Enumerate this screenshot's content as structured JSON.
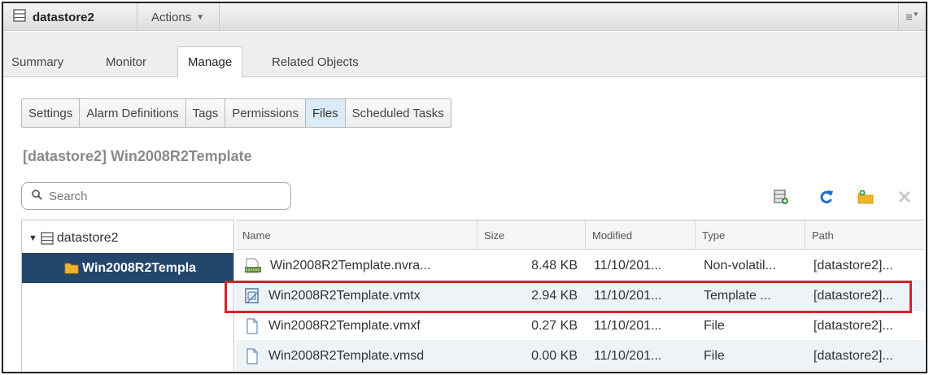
{
  "titlebar": {
    "object_name": "datastore2",
    "actions_label": "Actions",
    "menu_glyph": "≡"
  },
  "main_tabs": [
    "Summary",
    "Monitor",
    "Manage",
    "Related Objects"
  ],
  "main_tabs_active": "Manage",
  "sub_tabs": [
    "Settings",
    "Alarm Definitions",
    "Tags",
    "Permissions",
    "Files",
    "Scheduled Tasks"
  ],
  "sub_tabs_active": "Files",
  "heading": "[datastore2] Win2008R2Template",
  "search": {
    "placeholder": "Search",
    "value": ""
  },
  "toolbar_icons": [
    "register-vm-icon",
    "refresh-icon",
    "new-folder-icon",
    "delete-icon"
  ],
  "tree": {
    "root": "datastore2",
    "child": "Win2008R2Templa",
    "expanded": true
  },
  "grid": {
    "columns": [
      "Name",
      "Size",
      "Modified",
      "Type",
      "Path"
    ],
    "rows": [
      {
        "icon": "nvram-file-icon",
        "name": "Win2008R2Template.nvra...",
        "size": "8.48 KB",
        "modified": "11/10/201...",
        "type": "Non-volatil...",
        "path": "[datastore2]..."
      },
      {
        "icon": "template-file-icon",
        "name": "Win2008R2Template.vmtx",
        "size": "2.94 KB",
        "modified": "11/10/201...",
        "type": "Template ...",
        "path": "[datastore2]..."
      },
      {
        "icon": "file-icon",
        "name": "Win2008R2Template.vmxf",
        "size": "0.27 KB",
        "modified": "11/10/201...",
        "type": "File",
        "path": "[datastore2]..."
      },
      {
        "icon": "file-icon",
        "name": "Win2008R2Template.vmsd",
        "size": "0.00 KB",
        "modified": "11/10/201...",
        "type": "File",
        "path": "[datastore2]..."
      }
    ],
    "highlighted_row": 1
  },
  "colors": {
    "selection": "#24466b",
    "active_subtab": "#d9ecf7",
    "highlight_border": "#d4242c",
    "refresh_icon": "#1f6fc4",
    "folder_icon": "#f0b429"
  }
}
